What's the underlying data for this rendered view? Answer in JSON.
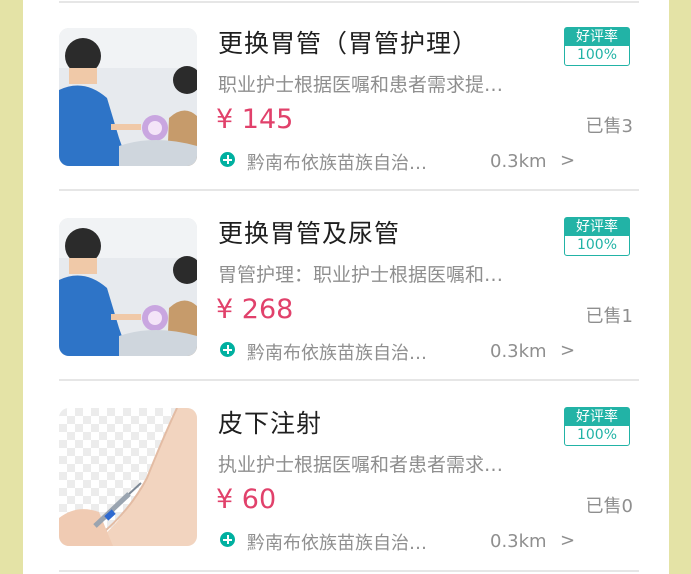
{
  "services": [
    {
      "title": "更换胃管（胃管护理）",
      "description": "职业护士根据医嘱和患者需求提…",
      "price": "¥ 145",
      "location": "黔南布依族苗族自治…",
      "distance": "0.3km",
      "rating_badge_label": "好评率",
      "rating_badge_value": "100%",
      "sold": "已售3",
      "image": "nurse-procedure-photo"
    },
    {
      "title": "更换胃管及尿管",
      "description": "胃管护理：职业护士根据医嘱和…",
      "price": "¥ 268",
      "location": "黔南布依族苗族自治…",
      "distance": "0.3km",
      "rating_badge_label": "好评率",
      "rating_badge_value": "100%",
      "sold": "已售1",
      "image": "nurse-procedure-photo"
    },
    {
      "title": "皮下注射",
      "description": "执业护士根据医嘱和者患者需求…",
      "price": "¥ 60",
      "location": "黔南布依族苗族自治…",
      "distance": "0.3km",
      "rating_badge_label": "好评率",
      "rating_badge_value": "100%",
      "sold": "已售0",
      "image": "arm-injection-photo"
    }
  ],
  "colors": {
    "price": "#e1416b",
    "accent": "#22b3a6",
    "location_icon": "#00b0a0",
    "outer_background": "#e4e3a6"
  }
}
